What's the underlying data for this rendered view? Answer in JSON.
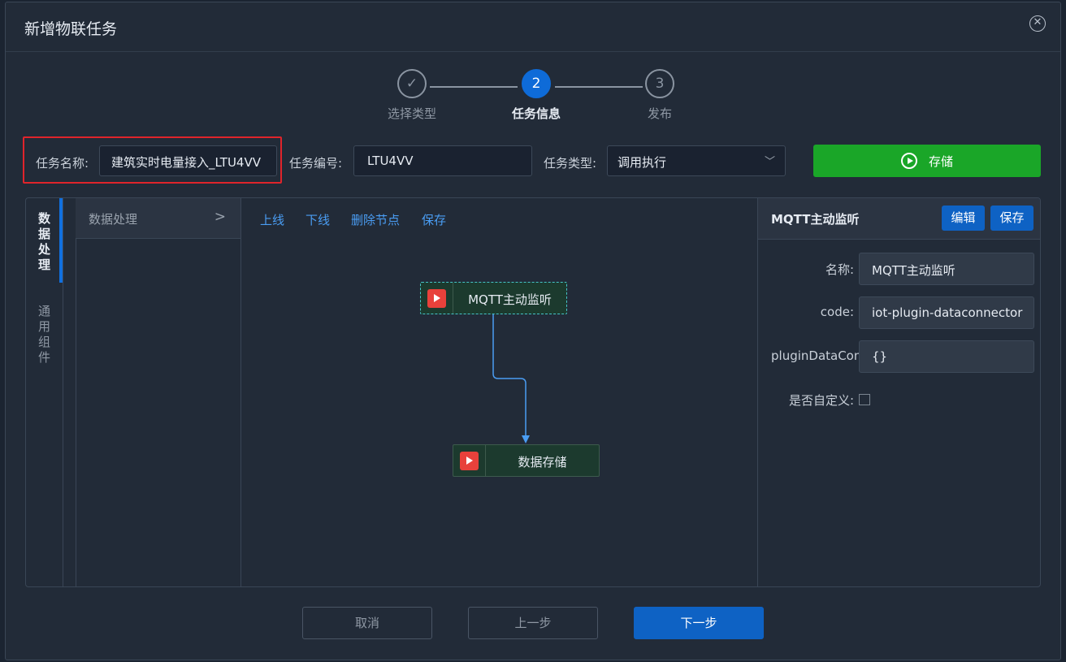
{
  "dialog": {
    "title": "新增物联任务"
  },
  "steps": [
    {
      "number": "✓",
      "label": "选择类型",
      "state": "done"
    },
    {
      "number": "2",
      "label": "任务信息",
      "state": "active"
    },
    {
      "number": "3",
      "label": "发布",
      "state": "pending"
    }
  ],
  "form": {
    "name_label": "任务名称:",
    "name_value": "建筑实时电量接入_LTU4VV",
    "code_label": "任务编号:",
    "code_value": "LTU4VV",
    "type_label": "任务类型:",
    "type_value": "调用执行",
    "save_label": "存储"
  },
  "left_tabs": [
    {
      "label": "数据处理",
      "active": true
    },
    {
      "label": "通用组件",
      "active": false
    }
  ],
  "category": {
    "label": "数据处理",
    "chevron": ">"
  },
  "canvas": {
    "toolbar": [
      "上线",
      "下线",
      "删除节点",
      "保存"
    ],
    "nodes": [
      {
        "label": "MQTT主动监听",
        "selected": true
      },
      {
        "label": "数据存储",
        "selected": false
      }
    ]
  },
  "props": {
    "title": "MQTT主动监听",
    "edit_label": "编辑",
    "save_label": "保存",
    "fields": {
      "name_label": "名称:",
      "name_value": "MQTT主动监听",
      "code_label": "code:",
      "code_value": "iot-plugin-dataconnector",
      "config_label": "pluginDataConfig",
      "config_value": "{}",
      "custom_label": "是否自定义:"
    }
  },
  "footer": {
    "cancel": "取消",
    "prev": "上一步",
    "next": "下一步"
  },
  "colors": {
    "accent": "#0e6bd8",
    "success": "#1aa628",
    "highlight": "#e0242b",
    "node_icon": "#e8413b",
    "link": "#4a9df3"
  }
}
